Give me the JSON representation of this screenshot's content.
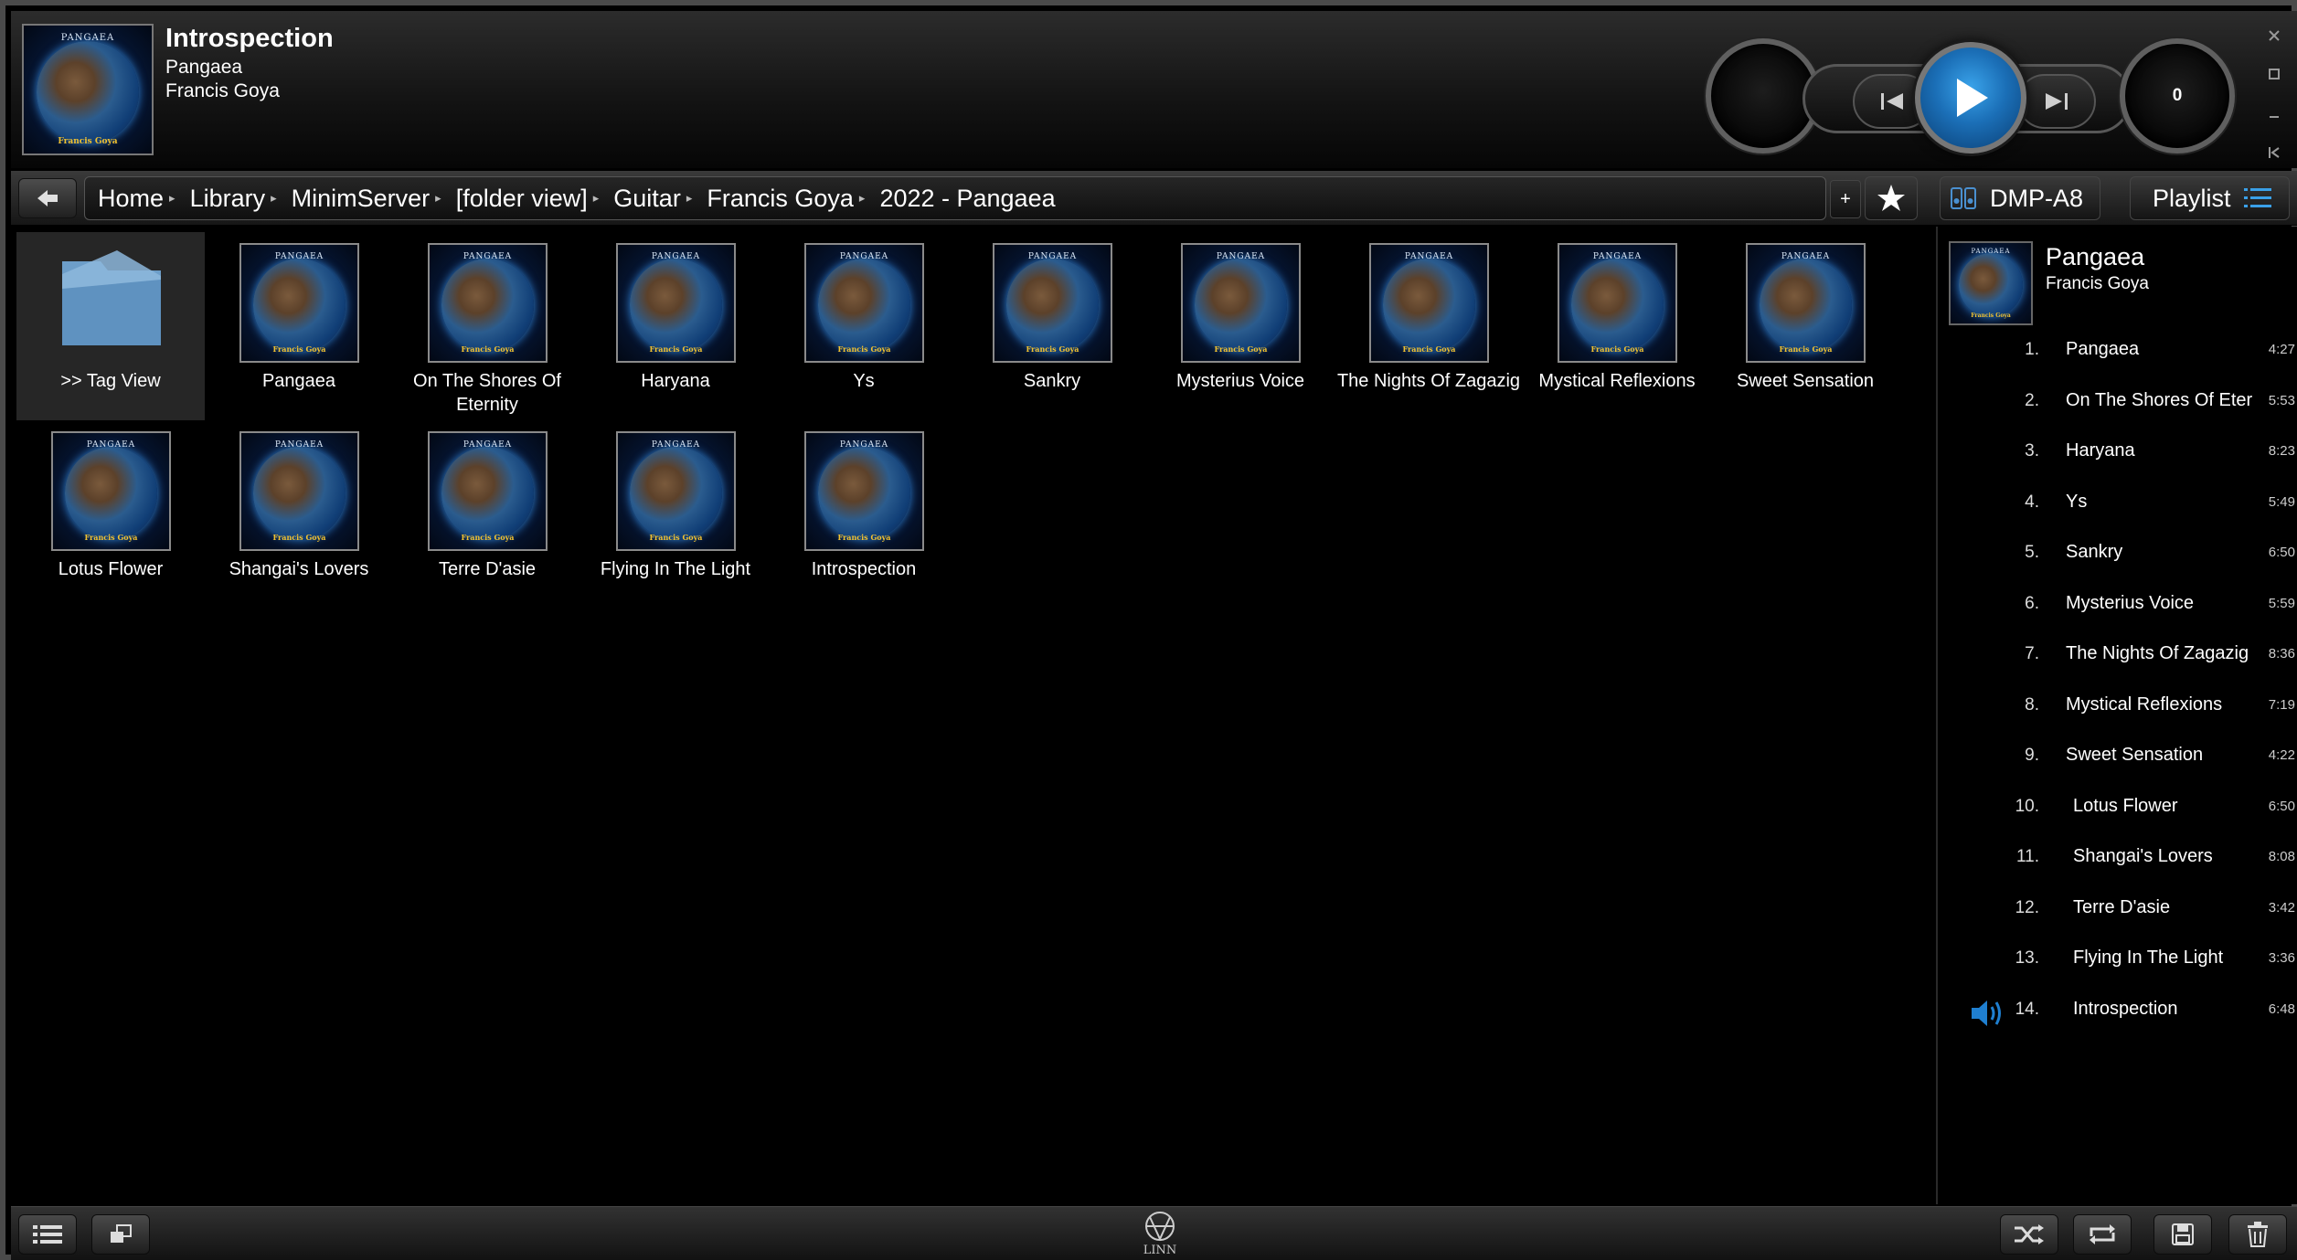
{
  "now_playing": {
    "title": "Introspection",
    "album": "Pangaea",
    "artist": "Francis Goya",
    "cover_top_text": "PANGAEA",
    "cover_bottom_text": "Francis Goya",
    "volume": "0"
  },
  "breadcrumb": [
    "Home",
    "Library",
    "MinimServer",
    "[folder view]",
    "Guitar",
    "Francis Goya",
    "2022 - Pangaea"
  ],
  "nav": {
    "add_label": "+",
    "room": "DMP-A8",
    "playlist_label": "Playlist"
  },
  "browser": {
    "folder_label": ">> Tag View",
    "cover_top_text": "PANGAEA",
    "cover_bottom_text": "Francis Goya",
    "albums": [
      "Pangaea",
      "On The Shores Of Eternity",
      "Haryana",
      "Ys",
      "Sankry",
      "Mysterius Voice",
      "The Nights Of Zagazig",
      "Mystical Reflexions",
      "Sweet Sensation",
      "Lotus Flower",
      "Shangai's Lovers",
      "Terre D'asie",
      "Flying In The Light",
      "Introspection"
    ]
  },
  "playlist": {
    "album": "Pangaea",
    "artist": "Francis Goya",
    "playing_index": 14,
    "tracks": [
      {
        "num": "1.",
        "title": "Pangaea",
        "duration": "4:27"
      },
      {
        "num": "2.",
        "title": "On The Shores Of Eternity",
        "duration": "5:53"
      },
      {
        "num": "3.",
        "title": "Haryana",
        "duration": "8:23"
      },
      {
        "num": "4.",
        "title": "Ys",
        "duration": "5:49"
      },
      {
        "num": "5.",
        "title": "Sankry",
        "duration": "6:50"
      },
      {
        "num": "6.",
        "title": "Mysterius Voice",
        "duration": "5:59"
      },
      {
        "num": "7.",
        "title": "The Nights Of Zagazig",
        "duration": "8:36"
      },
      {
        "num": "8.",
        "title": "Mystical Reflexions",
        "duration": "7:19"
      },
      {
        "num": "9.",
        "title": "Sweet Sensation",
        "duration": "4:22"
      },
      {
        "num": "10.",
        "title": "Lotus Flower",
        "duration": "6:50"
      },
      {
        "num": "11.",
        "title": "Shangai's Lovers",
        "duration": "8:08"
      },
      {
        "num": "12.",
        "title": "Terre D'asie",
        "duration": "3:42"
      },
      {
        "num": "13.",
        "title": "Flying In The Light",
        "duration": "3:36"
      },
      {
        "num": "14.",
        "title": "Introspection",
        "duration": "6:48"
      }
    ]
  },
  "footer": {
    "brand": "LINN"
  },
  "colors": {
    "accent": "#1f7fd0",
    "background": "#000000",
    "panel": "#262626"
  }
}
